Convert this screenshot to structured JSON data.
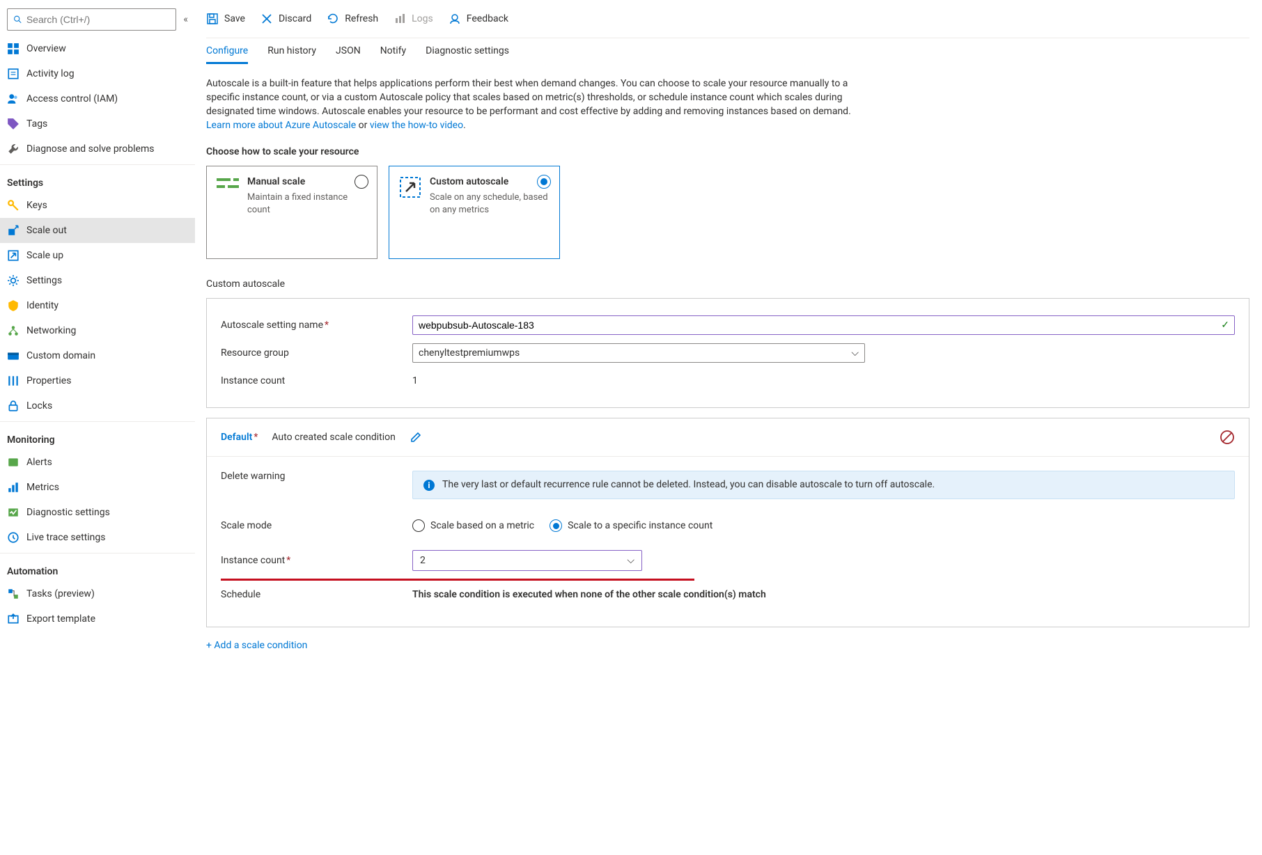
{
  "search": {
    "placeholder": "Search (Ctrl+/)"
  },
  "nav": {
    "top": [
      {
        "label": "Overview"
      },
      {
        "label": "Activity log"
      },
      {
        "label": "Access control (IAM)"
      },
      {
        "label": "Tags"
      },
      {
        "label": "Diagnose and solve problems"
      }
    ],
    "settingsHead": "Settings",
    "settings": [
      {
        "label": "Keys"
      },
      {
        "label": "Scale out"
      },
      {
        "label": "Scale up"
      },
      {
        "label": "Settings"
      },
      {
        "label": "Identity"
      },
      {
        "label": "Networking"
      },
      {
        "label": "Custom domain"
      },
      {
        "label": "Properties"
      },
      {
        "label": "Locks"
      }
    ],
    "monitoringHead": "Monitoring",
    "monitoring": [
      {
        "label": "Alerts"
      },
      {
        "label": "Metrics"
      },
      {
        "label": "Diagnostic settings"
      },
      {
        "label": "Live trace settings"
      }
    ],
    "automationHead": "Automation",
    "automation": [
      {
        "label": "Tasks (preview)"
      },
      {
        "label": "Export template"
      }
    ]
  },
  "toolbar": {
    "save": "Save",
    "discard": "Discard",
    "refresh": "Refresh",
    "logs": "Logs",
    "feedback": "Feedback"
  },
  "tabs": {
    "configure": "Configure",
    "runHistory": "Run history",
    "json": "JSON",
    "notify": "Notify",
    "diag": "Diagnostic settings"
  },
  "description": {
    "text": "Autoscale is a built-in feature that helps applications perform their best when demand changes. You can choose to scale your resource manually to a specific instance count, or via a custom Autoscale policy that scales based on metric(s) thresholds, or schedule instance count which scales during designated time windows. Autoscale enables your resource to be performant and cost effective by adding and removing instances based on demand. ",
    "learnMore": "Learn more about Azure Autoscale",
    "or": " or ",
    "howto": "view the how-to video",
    "period": "."
  },
  "chooseHead": "Choose how to scale your resource",
  "cards": {
    "manual": {
      "title": "Manual scale",
      "sub": "Maintain a fixed instance count"
    },
    "custom": {
      "title": "Custom autoscale",
      "sub": "Scale on any schedule, based on any metrics"
    }
  },
  "customHead": "Custom autoscale",
  "form": {
    "nameLabel": "Autoscale setting name",
    "nameValue": "webpubsub-Autoscale-183",
    "rgLabel": "Resource group",
    "rgValue": "chenyltestpremiumwps",
    "instLabel": "Instance count",
    "instValue": "1"
  },
  "cond": {
    "title": "Default",
    "subtitle": "Auto created scale condition",
    "delWarnLabel": "Delete warning",
    "delWarnText": "The very last or default recurrence rule cannot be deleted. Instead, you can disable autoscale to turn off autoscale.",
    "scaleModeLabel": "Scale mode",
    "modeMetric": "Scale based on a metric",
    "modeSpecific": "Scale to a specific instance count",
    "instLabel": "Instance count",
    "instValue": "2",
    "scheduleLabel": "Schedule",
    "scheduleText": "This scale condition is executed when none of the other scale condition(s) match"
  },
  "addCond": "+ Add a scale condition"
}
